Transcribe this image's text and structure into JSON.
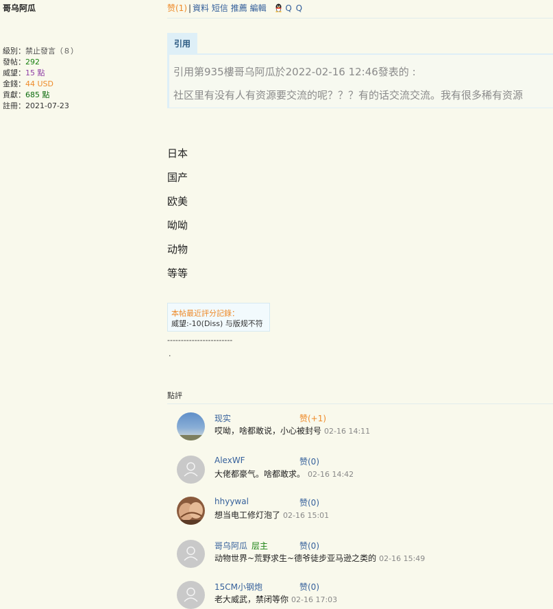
{
  "user": {
    "name": "哥乌阿瓜",
    "stats": [
      {
        "label": "級別：",
        "value": "禁止發言（８）",
        "color": "#555555"
      },
      {
        "label": "發帖：",
        "value": "292",
        "color": "#18800f"
      },
      {
        "label": "威望：",
        "value": "15 點",
        "color": "#8e3fa6"
      },
      {
        "label": "金錢：",
        "value": "44 USD",
        "color": "#ee8a29"
      },
      {
        "label": "貢獻：",
        "value": "685 點",
        "color": "#0b6a0b"
      },
      {
        "label": "註冊：",
        "value": "2021-07-23",
        "color": "#333333"
      }
    ]
  },
  "actions": {
    "like": "赞(1)",
    "separator": "|",
    "profile": "資料",
    "message": "短信",
    "recommend": "推薦",
    "edit": "編輯",
    "qq": "Q Q"
  },
  "quote": {
    "tag": "引用",
    "header": "引用第935樓哥乌阿瓜於2022-02-16 12:46發表的 :",
    "text": "社区里有没有人有资源要交流的呢？？？有的话交流交流。我有很多稀有资源"
  },
  "categories": [
    "日本",
    "国产",
    "欧美",
    "呦呦",
    "动物",
    "等等"
  ],
  "rating": {
    "title": "本帖最近評分記錄：",
    "detail": "威望:-10(Diss) 与版规不符"
  },
  "signature": {
    "dashes": "------------------------",
    "dot": "."
  },
  "comments": {
    "title": "點評",
    "items": [
      {
        "name": "现实",
        "badge": "",
        "like": "赞(+1)",
        "text": "哎呦，啥都敢说，小心被封号",
        "time": "02-16 14:11",
        "avatar": "sky-photo-avatar"
      },
      {
        "name": "AlexWF",
        "badge": "",
        "like": "赞(0)",
        "text": "大佬都豪气。啥都敢求。",
        "time": "02-16 14:42",
        "avatar": "default-avatar"
      },
      {
        "name": "hhyywal",
        "badge": "",
        "like": "赞(0)",
        "text": "想当电工修灯泡了",
        "time": "02-16 15:01",
        "avatar": "photo-avatar"
      },
      {
        "name": "哥乌阿瓜",
        "badge": "层主",
        "like": "赞(0)",
        "text": "动物世界~荒野求生~德爷徒步亚马逊之类的",
        "time": "02-16 15:49",
        "avatar": "default-avatar"
      },
      {
        "name": "15CM小钢炮",
        "badge": "",
        "like": "赞(0)",
        "text": "老大威武，禁闭等你",
        "time": "02-16 17:03",
        "avatar": "default-avatar"
      }
    ]
  }
}
